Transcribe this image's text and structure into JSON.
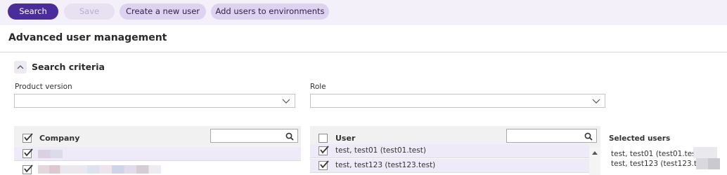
{
  "toolbar": {
    "search_label": "Search",
    "save_label": "Save",
    "create_user_label": "Create a new user",
    "add_users_label": "Add users to environments"
  },
  "page": {
    "title": "Advanced user management"
  },
  "search_criteria": {
    "title": "Search criteria",
    "product_version": {
      "label": "Product version",
      "value": ""
    },
    "role": {
      "label": "Role",
      "value": ""
    }
  },
  "company_grid": {
    "header": "Company",
    "filter_value": "",
    "header_checked": true,
    "rows": [
      {
        "checked": true,
        "name": ""
      },
      {
        "checked": true,
        "name": ""
      }
    ]
  },
  "user_grid": {
    "header": "User",
    "filter_value": "",
    "header_checked": false,
    "rows": [
      {
        "checked": true,
        "name": "test, test01 (test01.test)"
      },
      {
        "checked": true,
        "name": "test, test123 (test123.test)"
      }
    ]
  },
  "selected_users": {
    "title": "Selected users",
    "items": [
      "test, test01 (test01.test) ,",
      "test, test123 (test123.test)"
    ]
  },
  "colors": {
    "primary": "#4a2c9a",
    "toolbar_bg": "#f3f0f9",
    "selected_row": "#efeaf7"
  }
}
